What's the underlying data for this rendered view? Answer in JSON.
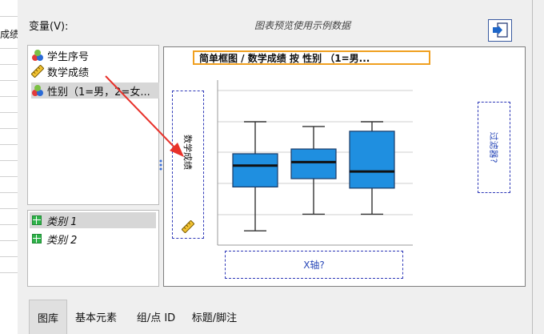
{
  "sheet": {
    "header_text": "成绩"
  },
  "dialog": {
    "variables_label": "变量(V):",
    "preview_note": "图表预览使用示例数据"
  },
  "variables": [
    {
      "label": "学生序号",
      "icon": "nominal-icon"
    },
    {
      "label": "数学成绩",
      "icon": "scale-ruler-icon"
    },
    {
      "label": "性别（1=男，2=女...",
      "icon": "nominal-icon"
    }
  ],
  "categories": [
    {
      "label": "类别 1"
    },
    {
      "label": "类别 2"
    }
  ],
  "chart": {
    "title": "简单框图 / 数学成绩 按 性别 （1=男...",
    "y_axis_label": "数学成绩",
    "x_axis_label": "X轴?",
    "filter_label": "过滤器?"
  },
  "chart_data": {
    "type": "box",
    "categories": [
      "",
      "",
      ""
    ],
    "series": [
      {
        "values": [
          {
            "min": 0.08,
            "q1": 0.45,
            "median": 0.63,
            "q3": 0.73,
            "max": 1.0
          },
          {
            "min": 0.22,
            "q1": 0.52,
            "median": 0.66,
            "q3": 0.77,
            "max": 0.96
          },
          {
            "min": 0.22,
            "q1": 0.44,
            "median": 0.58,
            "q3": 0.92,
            "max": 1.0
          }
        ]
      }
    ],
    "colors": {
      "box": "#1f8fe0",
      "whisker": "#333333"
    },
    "grid": true
  },
  "tabs": [
    {
      "label": "图库",
      "active": true
    },
    {
      "label": "基本元素",
      "active": false
    },
    {
      "label": "组/点 ID",
      "active": false
    },
    {
      "label": "标题/脚注",
      "active": false
    }
  ],
  "colors": {
    "accent": "#2f39b8",
    "title_border": "#f0a020",
    "arrow": "#e8312a"
  }
}
